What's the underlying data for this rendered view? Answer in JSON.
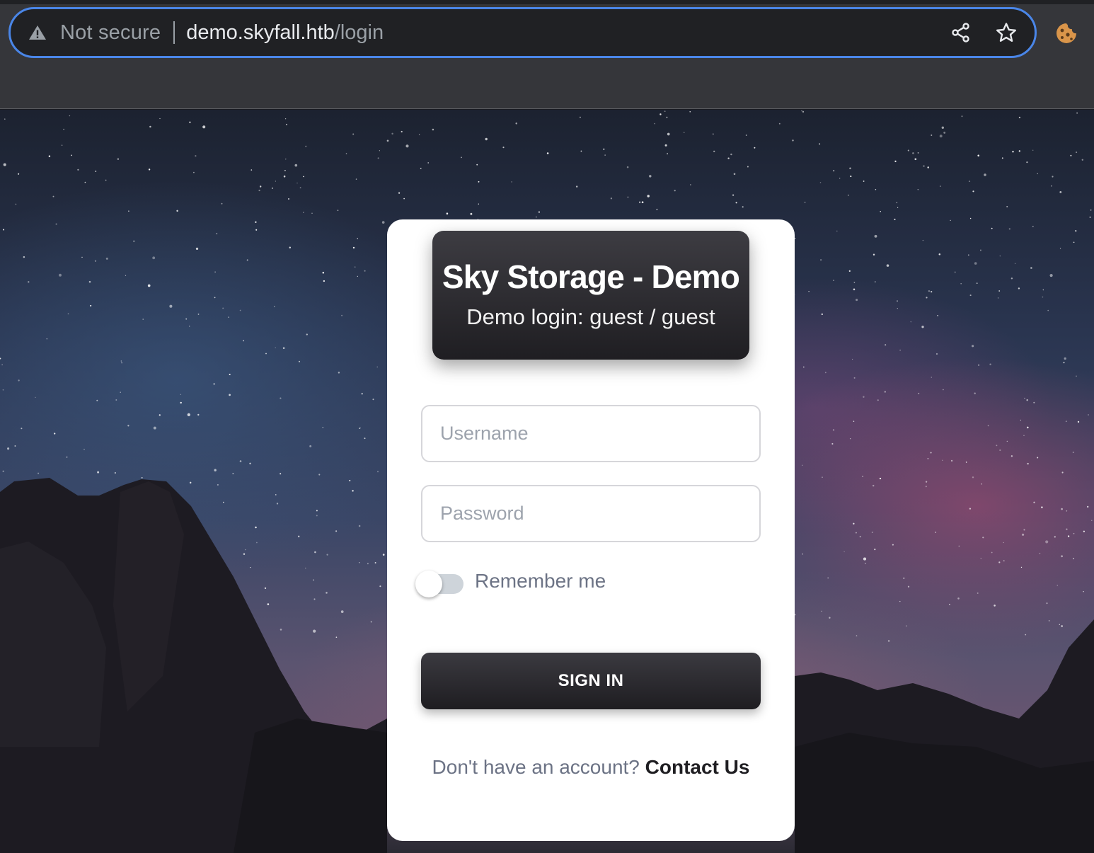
{
  "browser": {
    "security_label": "Not secure",
    "url_host": "demo.skyfall.htb",
    "url_path": "/login",
    "icons": [
      "warning-icon",
      "share-icon",
      "bookmark-star-icon",
      "cookie-extension-icon"
    ],
    "accent_color": "#4a86e8"
  },
  "login": {
    "title": "Sky Storage - Demo",
    "subtitle": "Demo login: guest / guest",
    "username_placeholder": "Username",
    "password_placeholder": "Password",
    "username_value": "",
    "password_value": "",
    "remember_label": "Remember me",
    "remember_checked": false,
    "signin_label": "SIGN IN",
    "signup_prompt": "Don't have an account?",
    "signup_link": "Contact Us"
  }
}
